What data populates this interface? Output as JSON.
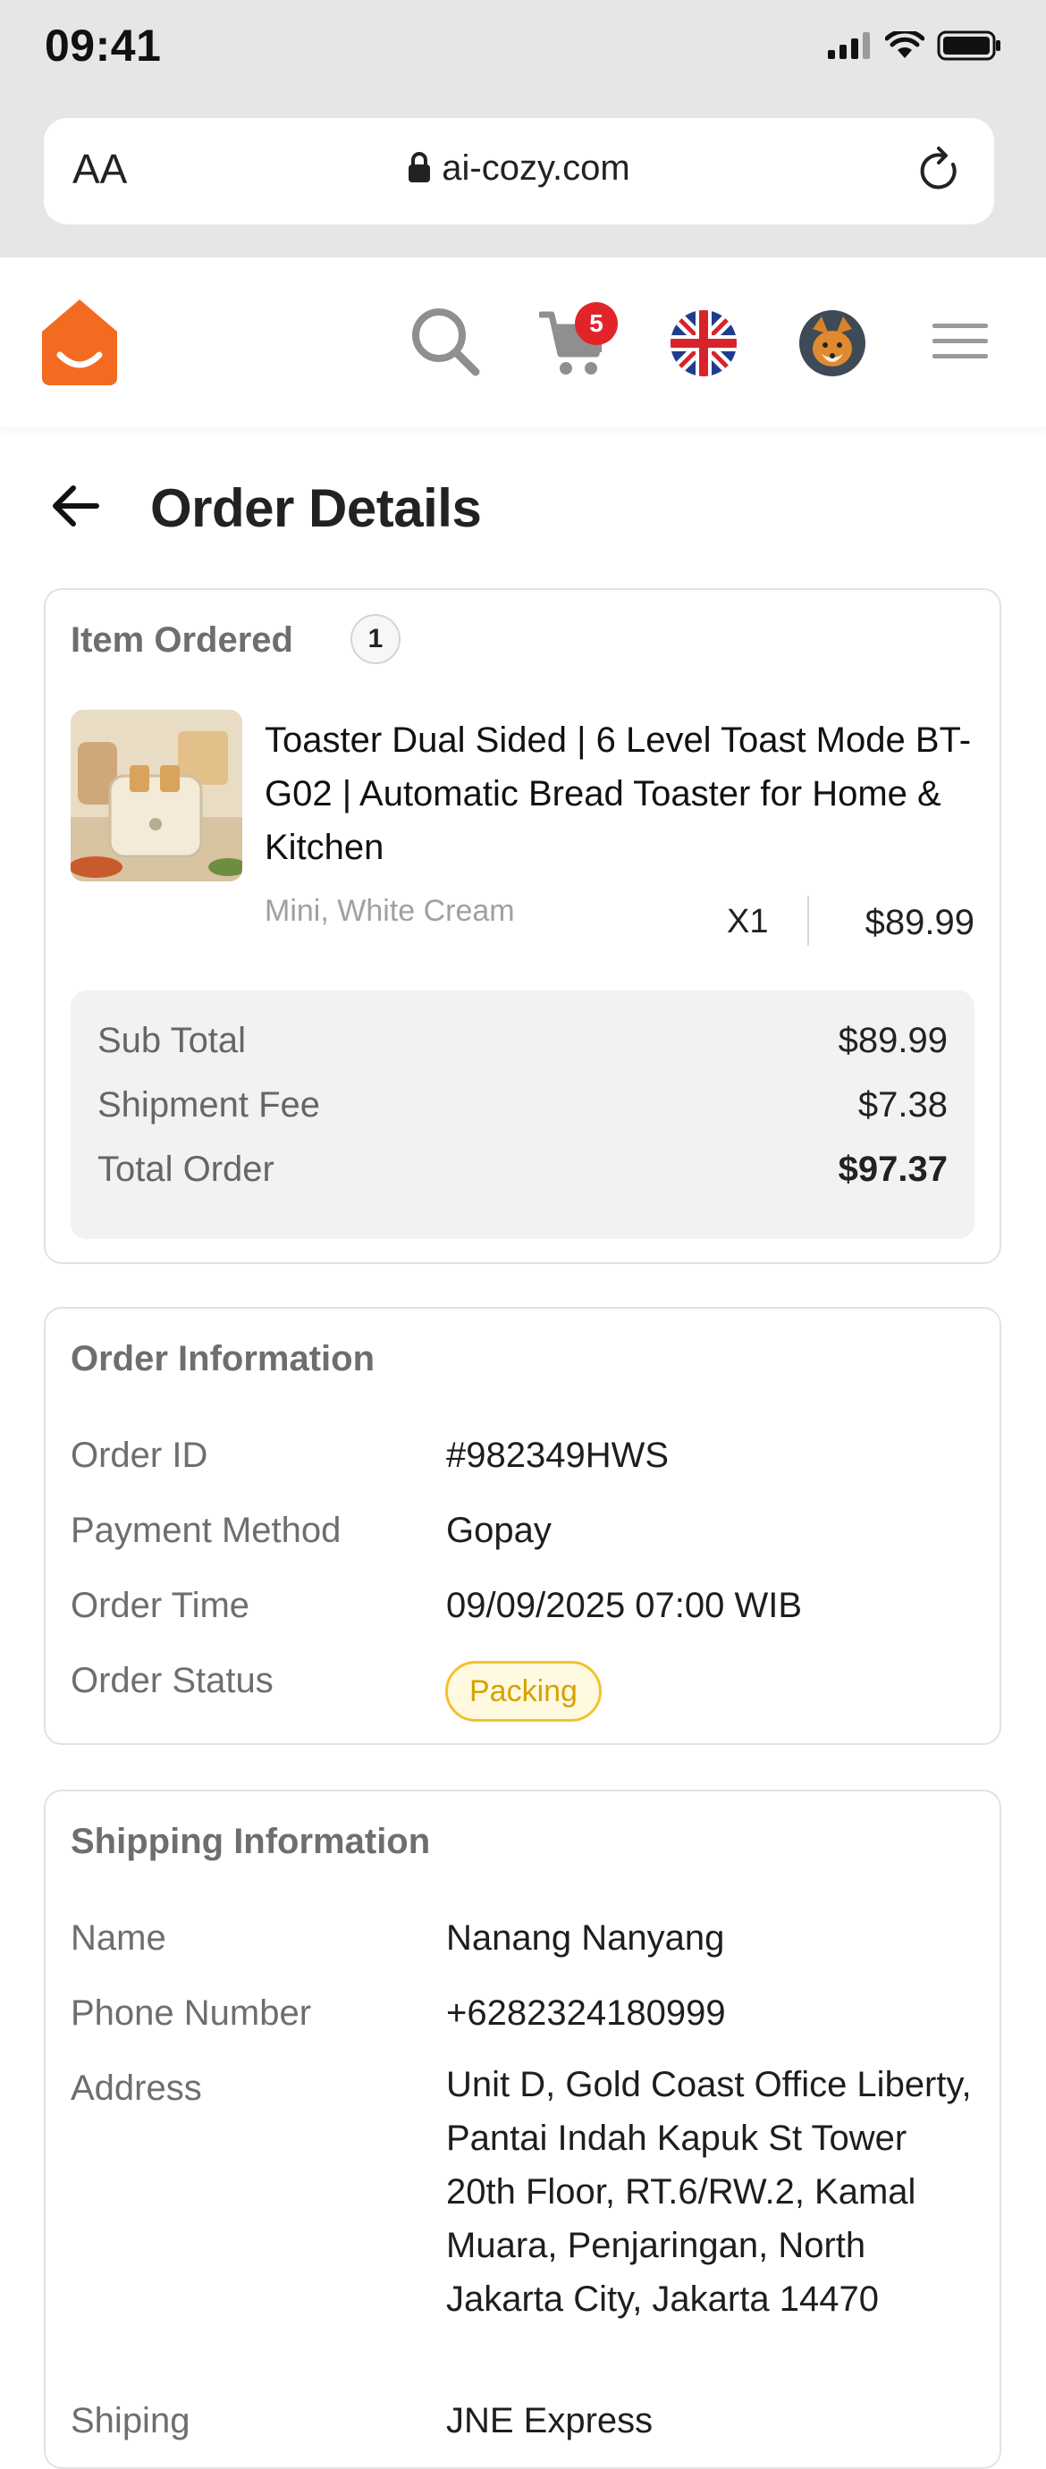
{
  "status_bar": {
    "time": "09:41"
  },
  "browser": {
    "text_size_label": "AA",
    "url": "ai-cozy.com"
  },
  "header": {
    "cart_count": "5"
  },
  "page": {
    "title": "Order Details"
  },
  "item_card": {
    "title": "Item Ordered",
    "count": "1",
    "product": {
      "name": "Toaster Dual Sided | 6 Level Toast Mode BT-G02 | Automatic Bread Toaster for Home & Kitchen",
      "variant": "Mini, White Cream",
      "quantity": "X1",
      "price": "$89.99"
    },
    "summary": {
      "subtotal_label": "Sub Total",
      "subtotal_value": "$89.99",
      "shipment_label": "Shipment Fee",
      "shipment_value": "$7.38",
      "total_label": "Total Order",
      "total_value": "$97.37"
    }
  },
  "order_info": {
    "title": "Order Information",
    "rows": [
      {
        "label": "Order ID",
        "value": "#982349HWS"
      },
      {
        "label": "Payment Method",
        "value": "Gopay"
      },
      {
        "label": "Order Time",
        "value": "09/09/2025 07:00 WIB"
      },
      {
        "label": "Order Status",
        "value": "Packing"
      }
    ]
  },
  "shipping_info": {
    "title": "Shipping Information",
    "rows": [
      {
        "label": "Name",
        "value": "Nanang Nanyang"
      },
      {
        "label": "Phone Number",
        "value": "+6282324180999"
      },
      {
        "label": "Address",
        "value": "Unit D, Gold Coast Office Liberty, Pantai Indah Kapuk St Tower 20th Floor, RT.6/RW.2, Kamal Muara, Penjaringan, North Jakarta City, Jakarta 14470"
      },
      {
        "label": "Shiping",
        "value": "JNE Express"
      }
    ]
  },
  "colors": {
    "brand": "#f26b21",
    "badge": "#e0242a",
    "status_border": "#f2c230",
    "status_text": "#d6a200"
  }
}
